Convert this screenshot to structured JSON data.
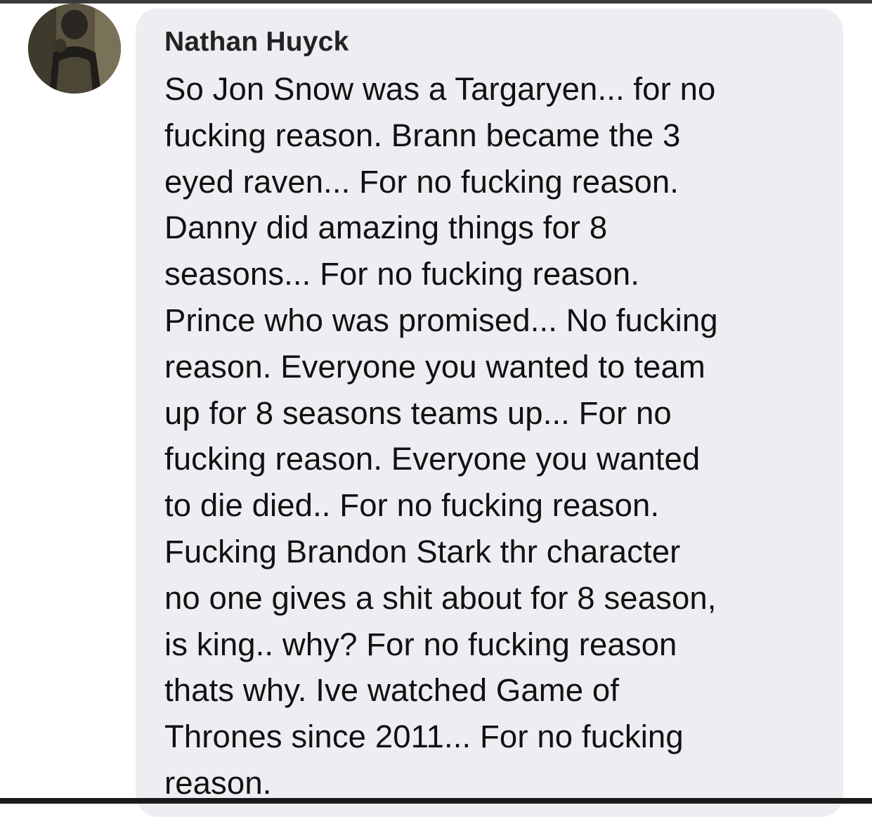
{
  "comment": {
    "author": "Nathan Huyck",
    "lines": [
      "So Jon Snow was a Targaryen... for no",
      "fucking reason. Brann became the 3",
      "eyed raven... For no fucking reason.",
      "Danny did amazing things for 8",
      "seasons... For no fucking reason.",
      "Prince who was promised... No fucking",
      "reason. Everyone you wanted to team",
      "up for 8 seasons teams up... For no",
      "fucking reason. Everyone you wanted",
      "to die died.. For no fucking reason.",
      "Fucking Brandon Stark thr character",
      "no one gives a shit about for 8 season,",
      "is king.. why? For no fucking reason",
      "thats why. Ive watched Game of",
      "Thrones since 2011... For no fucking",
      "reason."
    ]
  },
  "colors": {
    "bubble": "#edeef2",
    "text": "#111111",
    "author": "#222222"
  }
}
